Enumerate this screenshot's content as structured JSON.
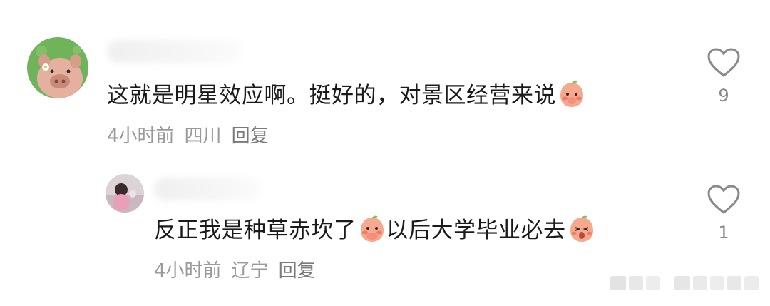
{
  "comments": [
    {
      "text": "这就是明星效应啊。挺好的，对景区经营来说",
      "time": "4小时前",
      "location": "四川",
      "reply_label": "回复",
      "likes": "9",
      "emoji": "blushing-peach-emoji"
    },
    {
      "text_a": "反正我是种草赤坎了",
      "text_b": "以后大学毕业必去",
      "time": "4小时前",
      "location": "辽宁",
      "reply_label": "回复",
      "likes": "1",
      "emoji": "peach-emoji"
    }
  ],
  "colors": {
    "meta": "#9a9a9a",
    "text": "#1a1a1a",
    "heart": "#8a8a8a",
    "peach": "#f6a98e"
  }
}
